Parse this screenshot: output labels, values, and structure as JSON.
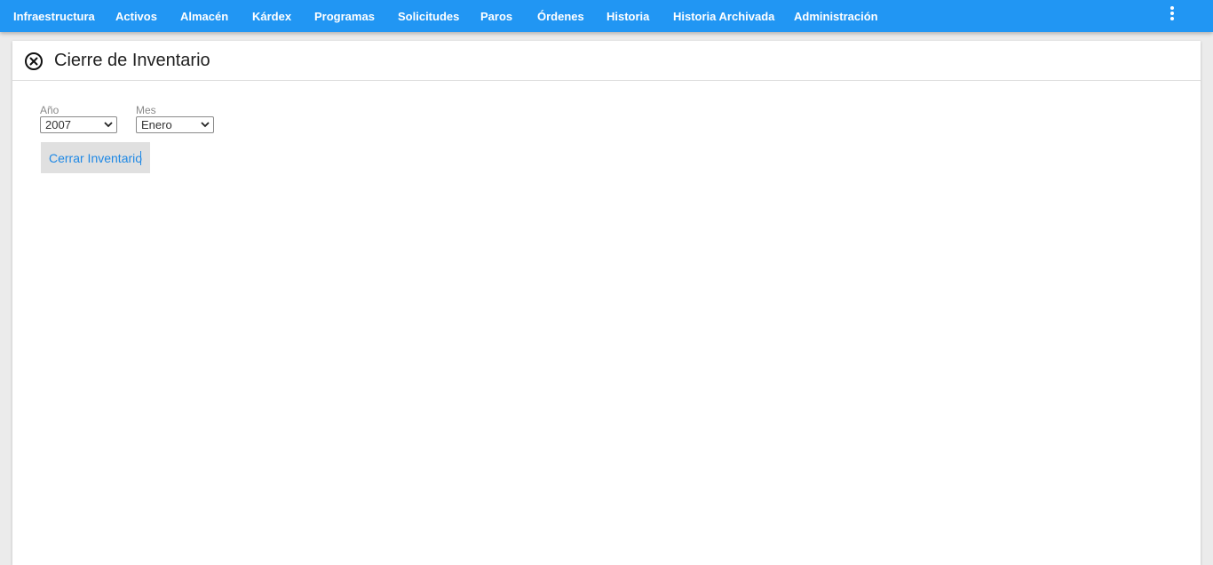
{
  "nav": {
    "items": [
      {
        "label": "Infraestructura"
      },
      {
        "label": "Activos"
      },
      {
        "label": "Almacén"
      },
      {
        "label": "Kárdex"
      },
      {
        "label": "Programas"
      },
      {
        "label": "Solicitudes"
      },
      {
        "label": "Paros"
      },
      {
        "label": "Órdenes"
      },
      {
        "label": "Historia"
      },
      {
        "label": "Historia Archivada"
      },
      {
        "label": "Administración"
      }
    ],
    "more_icon": "more-vertical-icon"
  },
  "panel": {
    "title": "Cierre de Inventario",
    "close_icon": "close-circle-icon",
    "year": {
      "label": "Año",
      "value": "2007"
    },
    "month": {
      "label": "Mes",
      "value": "Enero"
    },
    "submit_label": "Cerrar Inventario"
  },
  "colors": {
    "topbar": "#2196f3",
    "button_text": "#1e88e5",
    "button_bg": "#e0e0e0"
  }
}
